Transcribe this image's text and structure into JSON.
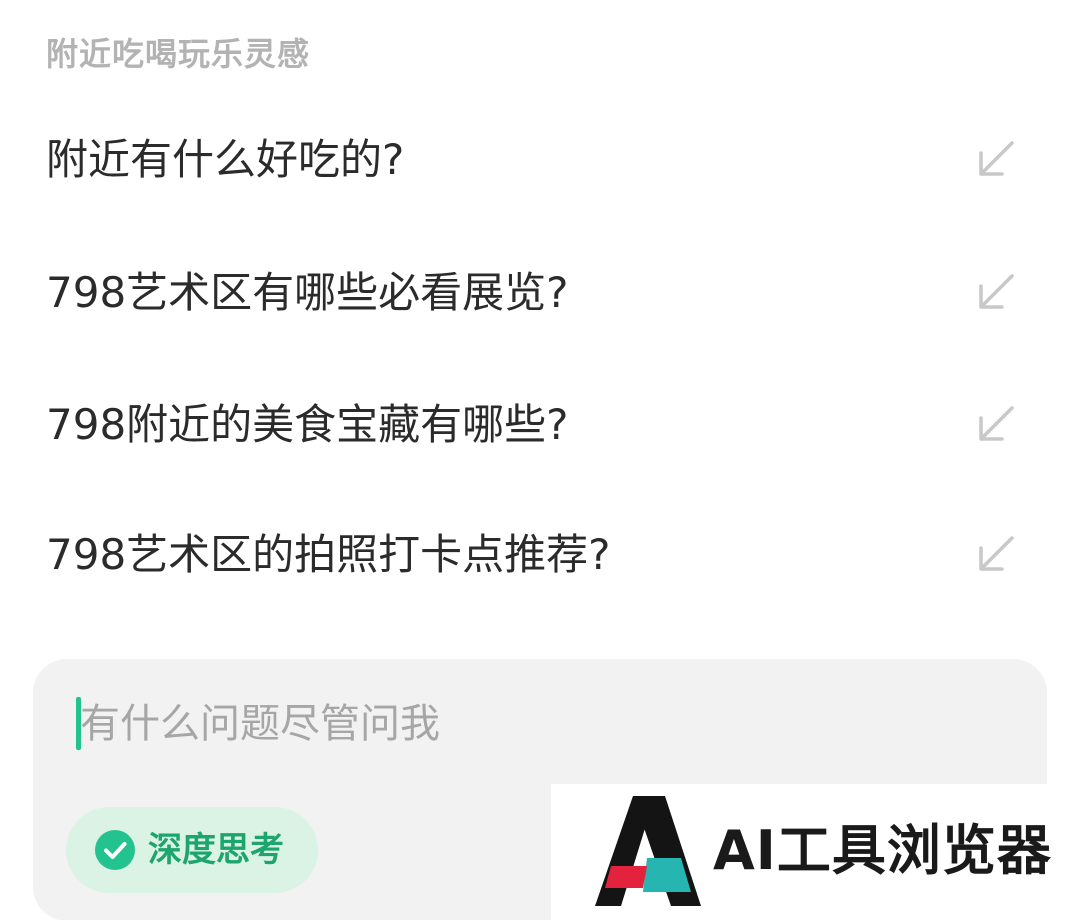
{
  "section": {
    "title": "附近吃喝玩乐灵感"
  },
  "suggestions": [
    {
      "label": "附近有什么好吃的?",
      "icon": "arrow-down-left-icon"
    },
    {
      "label": "798艺术区有哪些必看展览?",
      "icon": "arrow-down-left-icon"
    },
    {
      "label": "798附近的美食宝藏有哪些?",
      "icon": "arrow-down-left-icon"
    },
    {
      "label": "798艺术区的拍照打卡点推荐?",
      "icon": "arrow-down-left-icon"
    }
  ],
  "input": {
    "placeholder": "有什么问题尽管问我",
    "value": ""
  },
  "deep_think": {
    "label": "深度思考",
    "icon": "check-circle-icon",
    "active": true
  },
  "watermark": {
    "text": "AI工具浏览器"
  },
  "colors": {
    "accent": "#22c38e",
    "accent_text": "#1ea46d",
    "chip_background": "#daf3e4",
    "muted_text": "#b3b3b3",
    "arrow": "#c8c8c8",
    "panel_background": "#f2f2f2"
  }
}
